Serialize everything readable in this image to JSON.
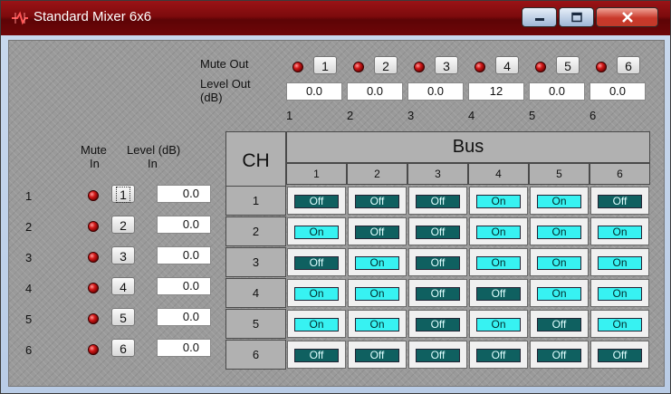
{
  "window": {
    "title": "Standard Mixer 6x6"
  },
  "output": {
    "mute_label": "Mute Out",
    "level_label_1": "Level Out",
    "level_label_2": "(dB)",
    "buttons": [
      "1",
      "2",
      "3",
      "4",
      "5",
      "6"
    ],
    "levels": [
      "0.0",
      "0.0",
      "0.0",
      "12",
      "0.0",
      "0.0"
    ],
    "channel_numbers": [
      "1",
      "2",
      "3",
      "4",
      "5",
      "6"
    ]
  },
  "input": {
    "mute_label_1": "Mute",
    "mute_label_2": "In",
    "level_label_1": "Level (dB)",
    "level_label_2": "In",
    "channel_numbers": [
      "1",
      "2",
      "3",
      "4",
      "5",
      "6"
    ],
    "buttons": [
      "1",
      "2",
      "3",
      "4",
      "5",
      "6"
    ],
    "levels": [
      "0.0",
      "0.0",
      "0.0",
      "0.0",
      "0.0",
      "0.0"
    ]
  },
  "matrix": {
    "ch_label": "CH",
    "bus_label": "Bus",
    "bus_numbers": [
      "1",
      "2",
      "3",
      "4",
      "5",
      "6"
    ],
    "rows": [
      {
        "ch": "1",
        "cells": [
          "Off",
          "Off",
          "Off",
          "On",
          "On",
          "Off"
        ]
      },
      {
        "ch": "2",
        "cells": [
          "On",
          "Off",
          "Off",
          "On",
          "On",
          "On"
        ]
      },
      {
        "ch": "3",
        "cells": [
          "Off",
          "On",
          "Off",
          "On",
          "On",
          "On"
        ]
      },
      {
        "ch": "4",
        "cells": [
          "On",
          "On",
          "Off",
          "Off",
          "On",
          "On"
        ]
      },
      {
        "ch": "5",
        "cells": [
          "On",
          "On",
          "Off",
          "On",
          "Off",
          "On"
        ]
      },
      {
        "ch": "6",
        "cells": [
          "Off",
          "Off",
          "Off",
          "Off",
          "Off",
          "Off"
        ]
      }
    ]
  },
  "colors": {
    "on": "#37f2f2",
    "off": "#0f6060",
    "led": "#d11818",
    "title_bar": "#7d0b0d"
  }
}
